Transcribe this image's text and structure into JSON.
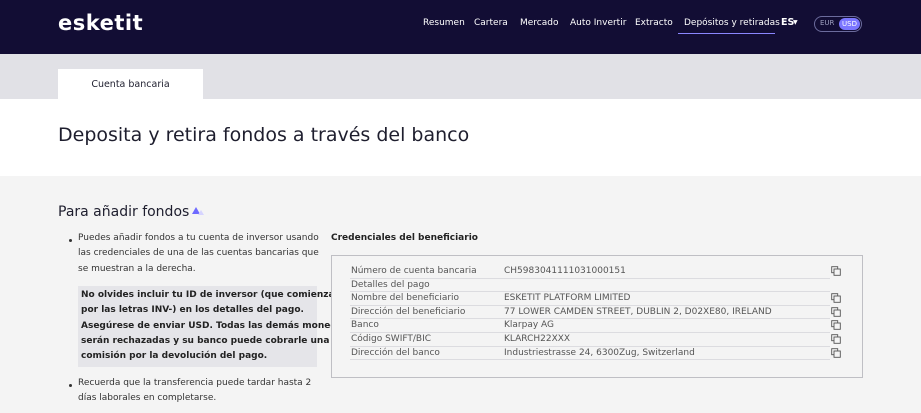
{
  "header": {
    "logo": "esketit",
    "nav": [
      "Resumen",
      "Cartera",
      "Mercado",
      "Auto Invertir",
      "Extracto",
      "Depósitos y retiradas"
    ],
    "language": "ES",
    "currency": {
      "options": [
        "EUR",
        "USD"
      ],
      "selected": "USD"
    }
  },
  "tabs": [
    "Cuenta bancaria"
  ],
  "page_title": "Deposita y retira fondos a través del banco",
  "add_funds": {
    "title": "Para añadir fondos",
    "bullet1": [
      "Puedes añadir fondos a tu cuenta de inversor usando",
      "las credenciales de una de las cuentas bancarias que",
      "se muestran a la derecha."
    ],
    "warning": [
      "No olvides incluir tu ID de inversor (que comienza",
      "por las letras INV-) en los detalles del pago.",
      "Asegúrese de enviar USD. Todas las demás monedas",
      "serán rechazadas y su banco puede cobrarle una",
      "comisión por la devolución del pago."
    ],
    "bullet2": [
      "Recuerda que la transferencia puede tardar hasta 2",
      "días laborales en completarse."
    ]
  },
  "credentials": {
    "title": "Credenciales del beneficiario",
    "rows": [
      {
        "label": "Número de cuenta bancaria",
        "value": "CH5983041111031000151",
        "copy": true
      },
      {
        "label": "Detalles del pago",
        "value": "",
        "copy": false
      },
      {
        "label": "Nombre del beneficiario",
        "value": "ESKETIT PLATFORM LIMITED",
        "copy": true
      },
      {
        "label": "Dirección del beneficiario",
        "value": "77 LOWER CAMDEN STREET, DUBLIN 2, D02XE80, IRELAND",
        "copy": true
      },
      {
        "label": "Banco",
        "value": "Klarpay AG",
        "copy": true
      },
      {
        "label": "Código SWIFT/BIC",
        "value": "KLARCH22XXX",
        "copy": true
      },
      {
        "label": "Dirección del banco",
        "value": "Industriestrasse 24, 6300Zug, Switzerland",
        "copy": true
      }
    ]
  }
}
